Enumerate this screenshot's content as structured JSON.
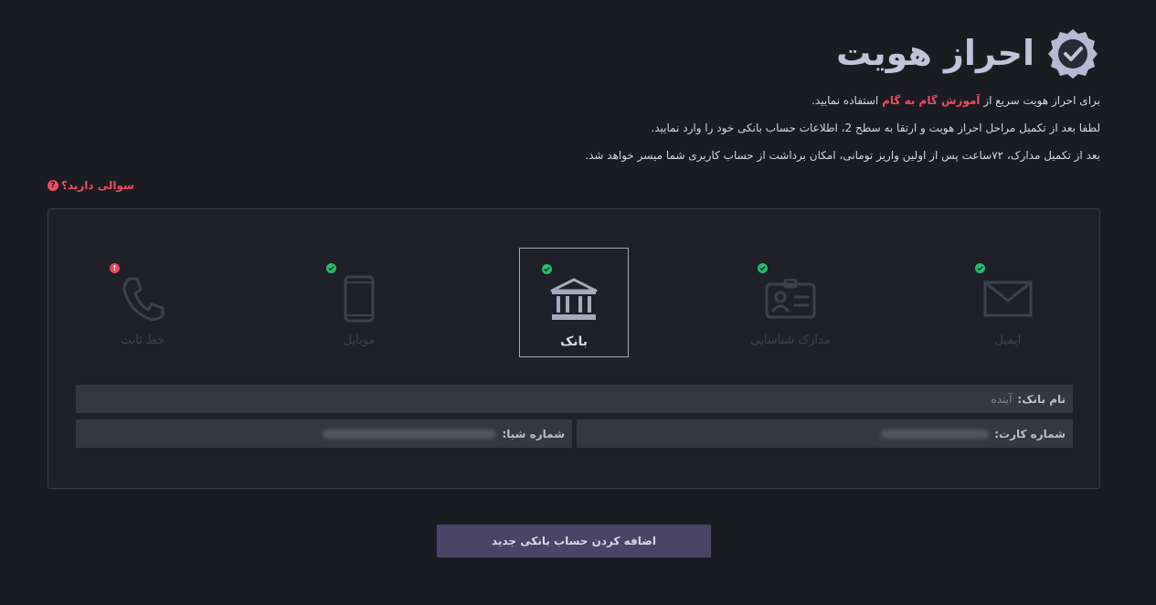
{
  "header": {
    "title": "احراز هویت",
    "badge_icon": "verified-badge-icon"
  },
  "intro": {
    "line1_prefix": "برای احراز هویت سریع از",
    "line1_link": "آموزش گام به گام",
    "line1_suffix": "استفاده نمایید.",
    "line2": "لطفا بعد از تکمیل مراحل احراز هویت و ارتقا به سطح 2، اطلاعات حساب بانکی خود را وارد نمایید.",
    "line3": "بعد از تکمیل مدارک، ۷۲ساعت پس از اولین واریز تومانی، امکان برداشت از حساب کاربری شما میسر خواهد شد."
  },
  "question": {
    "label": "سوالی دارید؟",
    "icon": "question-icon"
  },
  "steps": [
    {
      "label": "ایمیل",
      "icon": "envelope-icon",
      "status": "ok"
    },
    {
      "label": "مدارک شناسایی",
      "icon": "id-card-icon",
      "status": "ok"
    },
    {
      "label": "بانک",
      "icon": "bank-icon",
      "status": "ok",
      "active": true
    },
    {
      "label": "موبایل",
      "icon": "mobile-icon",
      "status": "ok"
    },
    {
      "label": "خط ثابت",
      "icon": "phone-icon",
      "status": "error"
    }
  ],
  "bank_form": {
    "bank_name_label": "نام بانک:",
    "bank_name_value": "آینده",
    "card_number_label": "شماره کارت:",
    "sheba_label": "شماره شبا:"
  },
  "add_button": {
    "label": "اضافه کردن حساب بانکی جدید"
  },
  "colors": {
    "background": "#1b1c22",
    "panel": "#1f2029",
    "accent_red": "#ef4b63",
    "ok_green": "#1fbf6b",
    "button": "#4a4566"
  }
}
